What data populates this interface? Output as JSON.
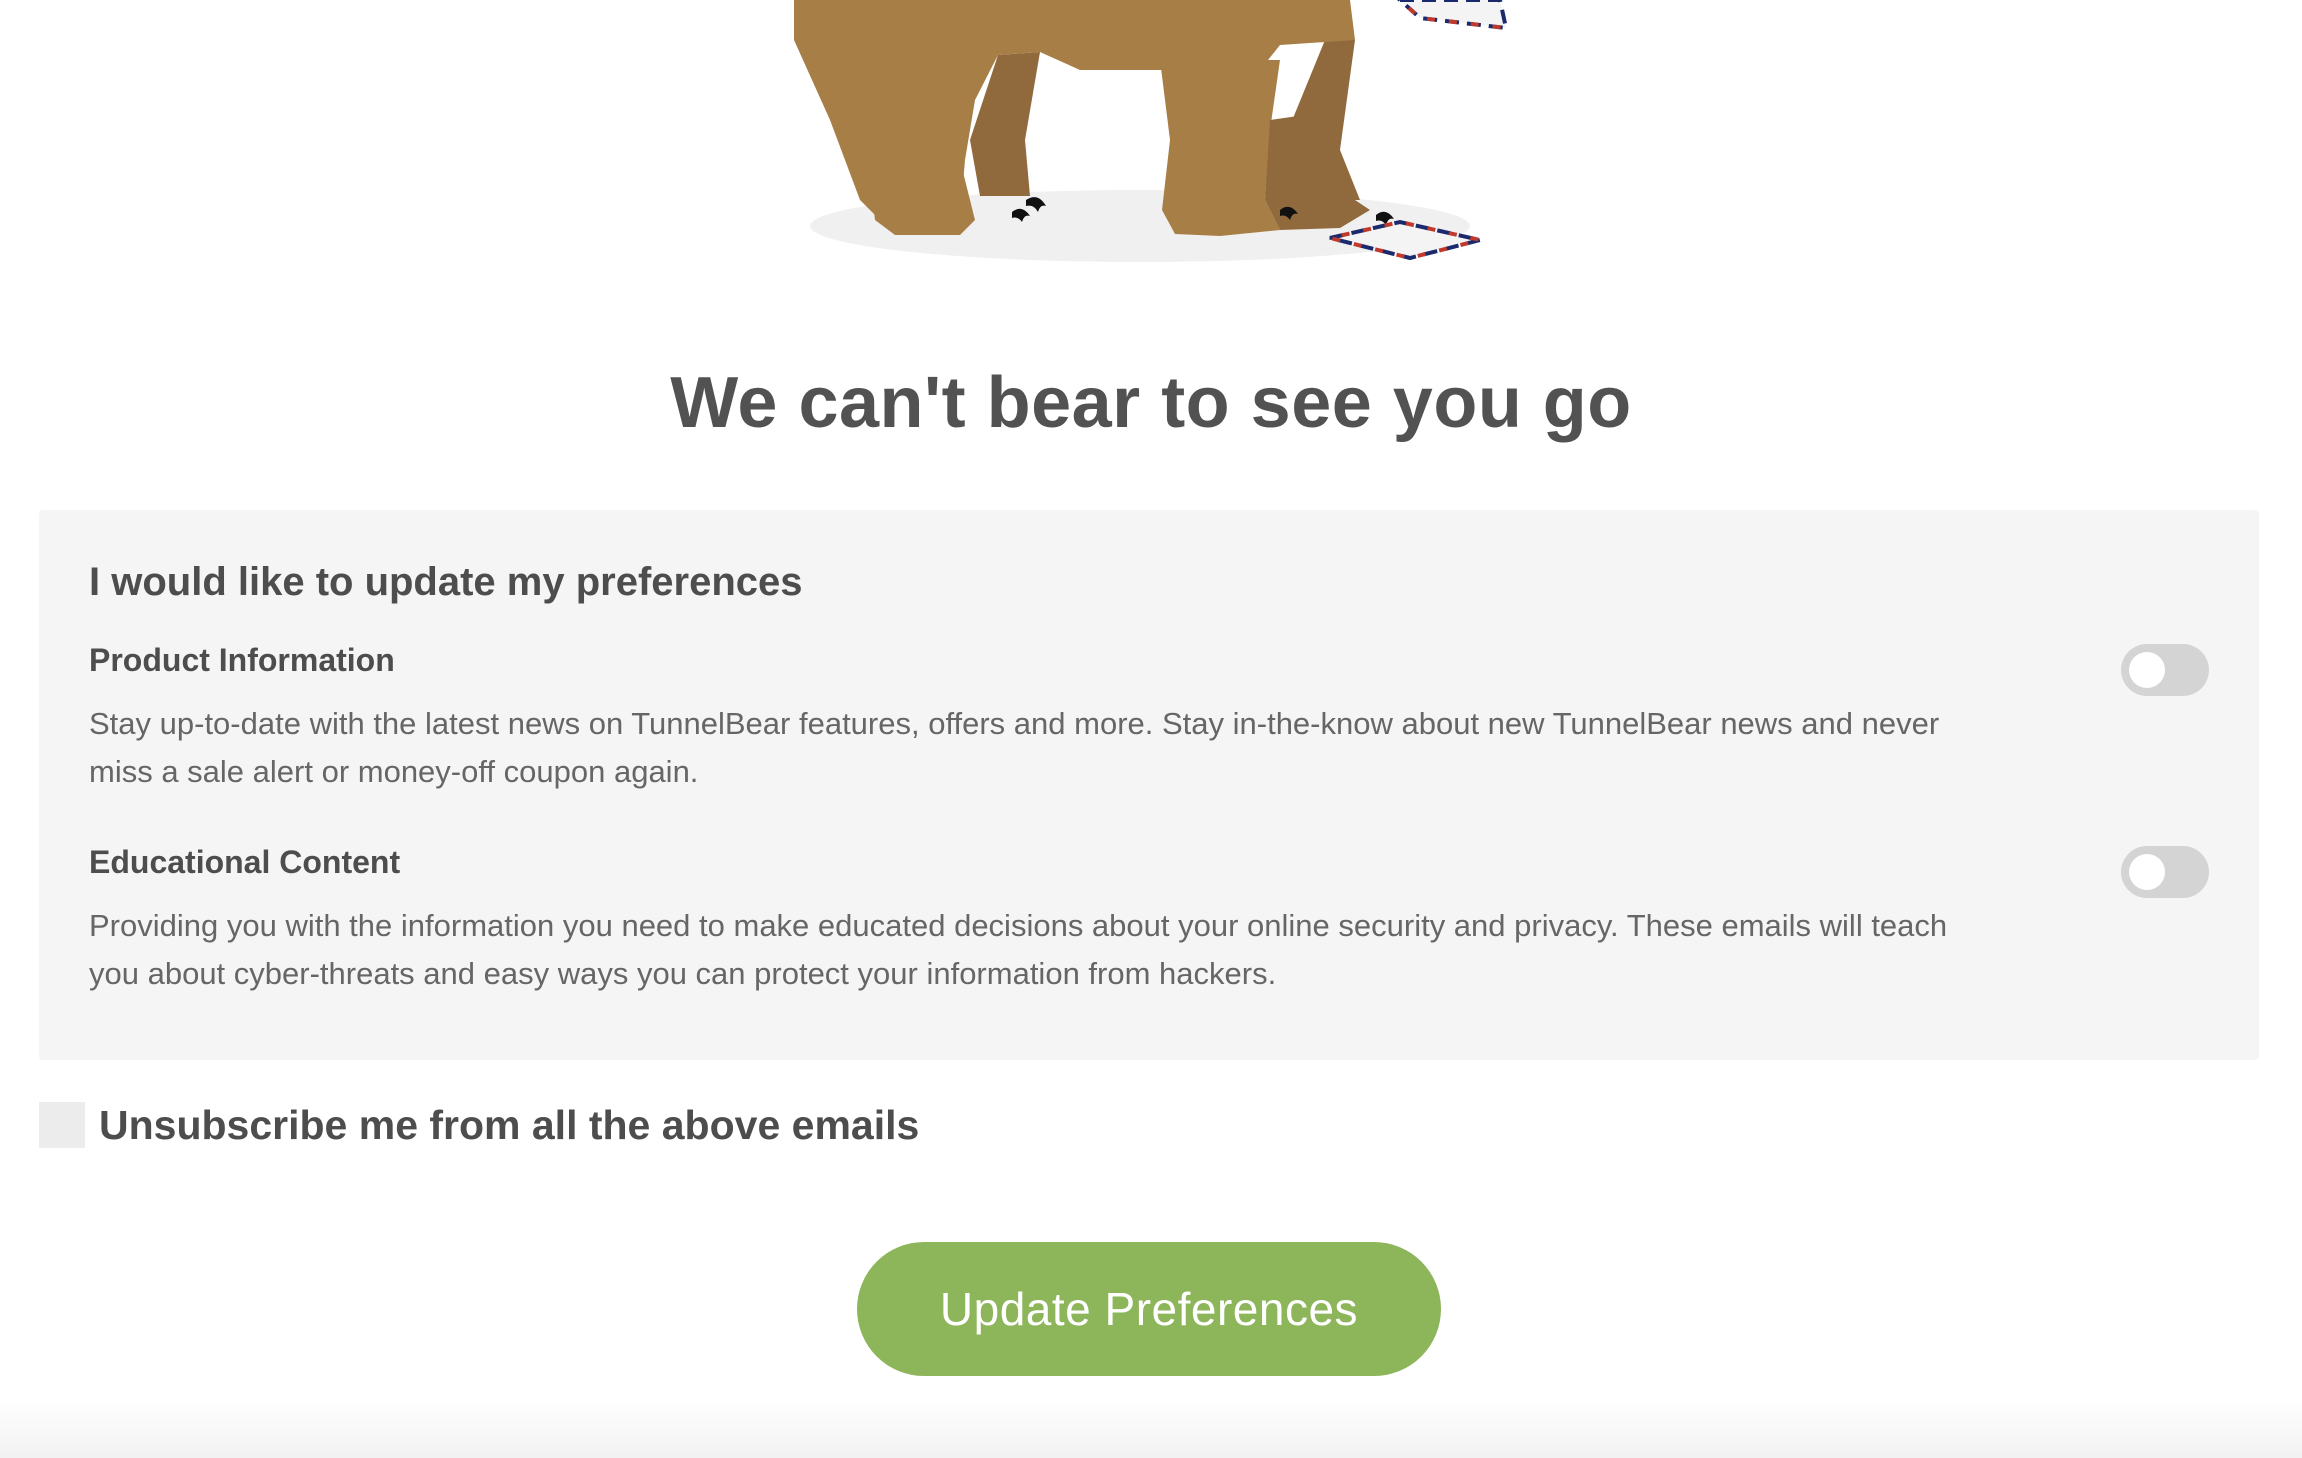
{
  "hero": {
    "illustration": "bear-with-envelopes-illustration"
  },
  "headline": "We can't bear to see you go",
  "preferences": {
    "title": "I would like to update my preferences",
    "items": [
      {
        "name": "Product Information",
        "description": "Stay up-to-date with the latest news on TunnelBear features, offers and more. Stay in-the-know about new TunnelBear news and never miss a sale alert or money-off coupon again.",
        "enabled": false
      },
      {
        "name": "Educational Content",
        "description": "Providing you with the information you need to make educated decisions about your online security and privacy. These emails will teach you about cyber-threats and easy ways you can protect your information from hackers.",
        "enabled": false
      }
    ]
  },
  "unsubscribe": {
    "label": "Unsubscribe me from all the above emails",
    "checked": false
  },
  "actions": {
    "update_label": "Update Preferences"
  },
  "colors": {
    "accent_green": "#8db55a",
    "panel_bg": "#f5f5f5",
    "toggle_off": "#d4d4d4",
    "bear_brown": "#a87e47",
    "bear_shadow": "#906a3d"
  }
}
